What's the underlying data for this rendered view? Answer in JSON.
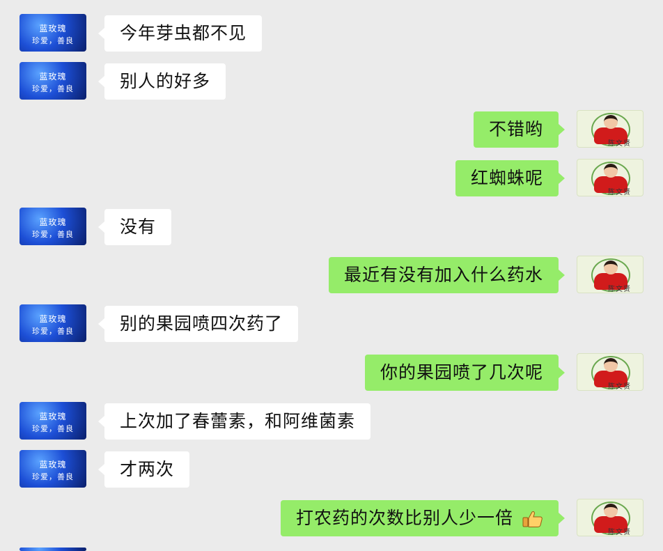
{
  "contacts": {
    "left": {
      "line1": "蓝玫瑰",
      "line2": "珍爱，善良"
    },
    "right": {
      "name": "陈文贤"
    }
  },
  "messages": [
    {
      "side": "left",
      "text": "今年芽虫都不见"
    },
    {
      "side": "left",
      "text": "别人的好多"
    },
    {
      "side": "right",
      "text": "不错哟"
    },
    {
      "side": "right",
      "text": "红蜘蛛呢"
    },
    {
      "side": "left",
      "text": "没有"
    },
    {
      "side": "right",
      "text": "最近有没有加入什么药水"
    },
    {
      "side": "left",
      "text": "别的果园喷四次药了"
    },
    {
      "side": "right",
      "text": "你的果园喷了几次呢"
    },
    {
      "side": "left",
      "text": "上次加了春蕾素，和阿维菌素"
    },
    {
      "side": "left",
      "text": "才两次"
    },
    {
      "side": "right",
      "text": "打农药的次数比别人少一倍",
      "emoji": "thumbs-up-icon"
    }
  ],
  "colors": {
    "background": "#ebebeb",
    "bubble_left": "#ffffff",
    "bubble_right": "#95ec69"
  }
}
